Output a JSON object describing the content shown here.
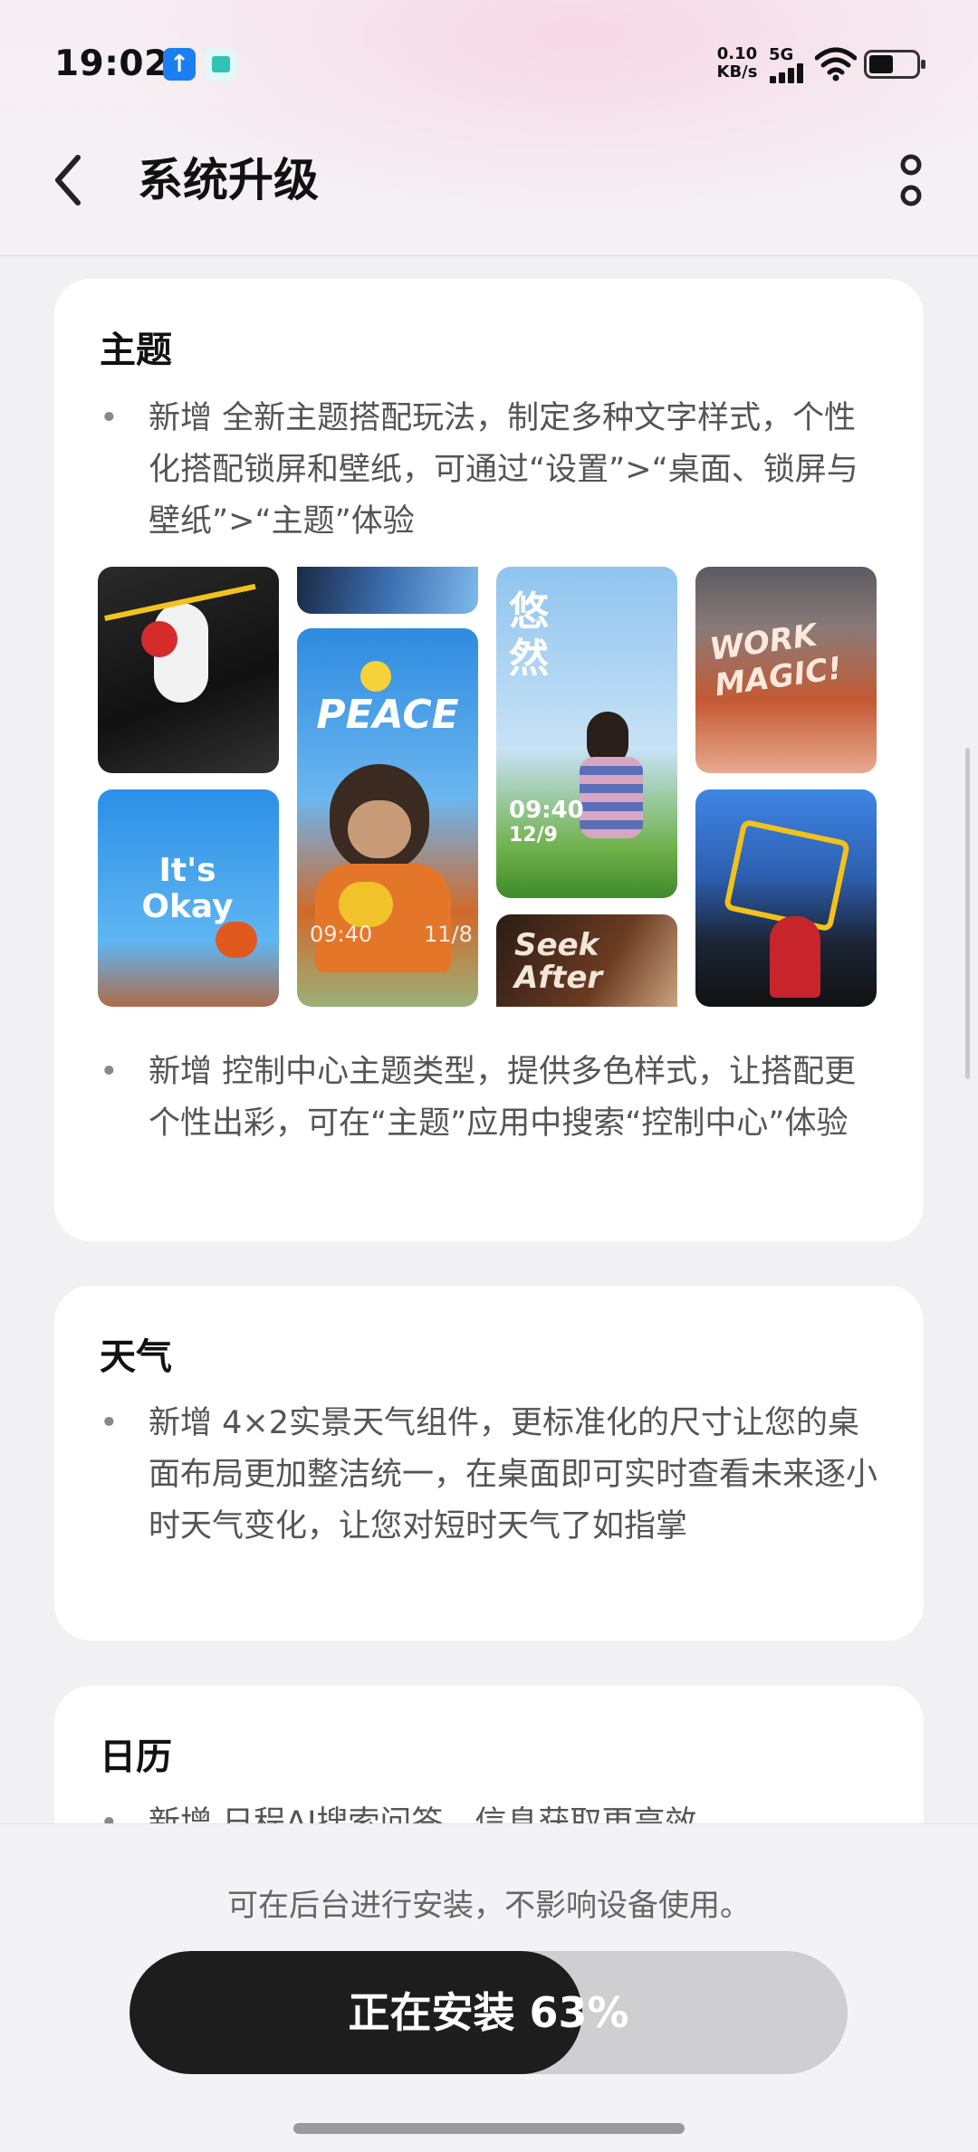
{
  "status_bar": {
    "time": "19:02",
    "net_speed_value": "0.10",
    "net_speed_unit": "KB/s",
    "network": "5G",
    "icons": [
      "upload-notification-icon",
      "app-notification-icon",
      "signal-icon",
      "wifi-icon",
      "battery-icon"
    ]
  },
  "header": {
    "title": "系统升级",
    "back_icon": "chevron-left-icon",
    "more_icon": "more-vertical-icon"
  },
  "sections": [
    {
      "title": "主题",
      "items": [
        "新增 全新主题搭配玩法，制定多种文字样式，个性化搭配锁屏和壁纸，可通过“设置”>“桌面、锁屏与壁纸”>“主题”体验",
        "新增 控制中心主题类型，提供多色样式，让搭配更个性出彩，可在“主题”应用中搜索“控制中心”体验"
      ],
      "theme_previews": [
        {
          "text": ""
        },
        {
          "text": "It's Okay"
        },
        {
          "text": "PEACE",
          "time": "09:40",
          "date": "11/8"
        },
        {
          "text": "悠然",
          "time": "09:40",
          "date": "12/9"
        },
        {
          "text": "Seek After"
        },
        {
          "text": "WORK MAGIC!"
        },
        {
          "text": ""
        }
      ]
    },
    {
      "title": "天气",
      "items": [
        "新增 4×2实景天气组件，更标准化的尺寸让您的桌面布局更加整洁统一，在桌面即可实时查看未来逐小时天气变化，让您对短时天气了如指掌"
      ]
    },
    {
      "title": "日历",
      "items": [
        "新增 日程AI搜索问答，信息获取更高效"
      ]
    }
  ],
  "footer": {
    "hint": "可在后台进行安装，不影响设备使用。",
    "install_label": "正在安装 63%",
    "progress": 0.63
  },
  "colors": {
    "accent_dark": "#1d1d1d",
    "progress_track": "#cfcfd1",
    "page_bg": "#f1f1f4"
  }
}
